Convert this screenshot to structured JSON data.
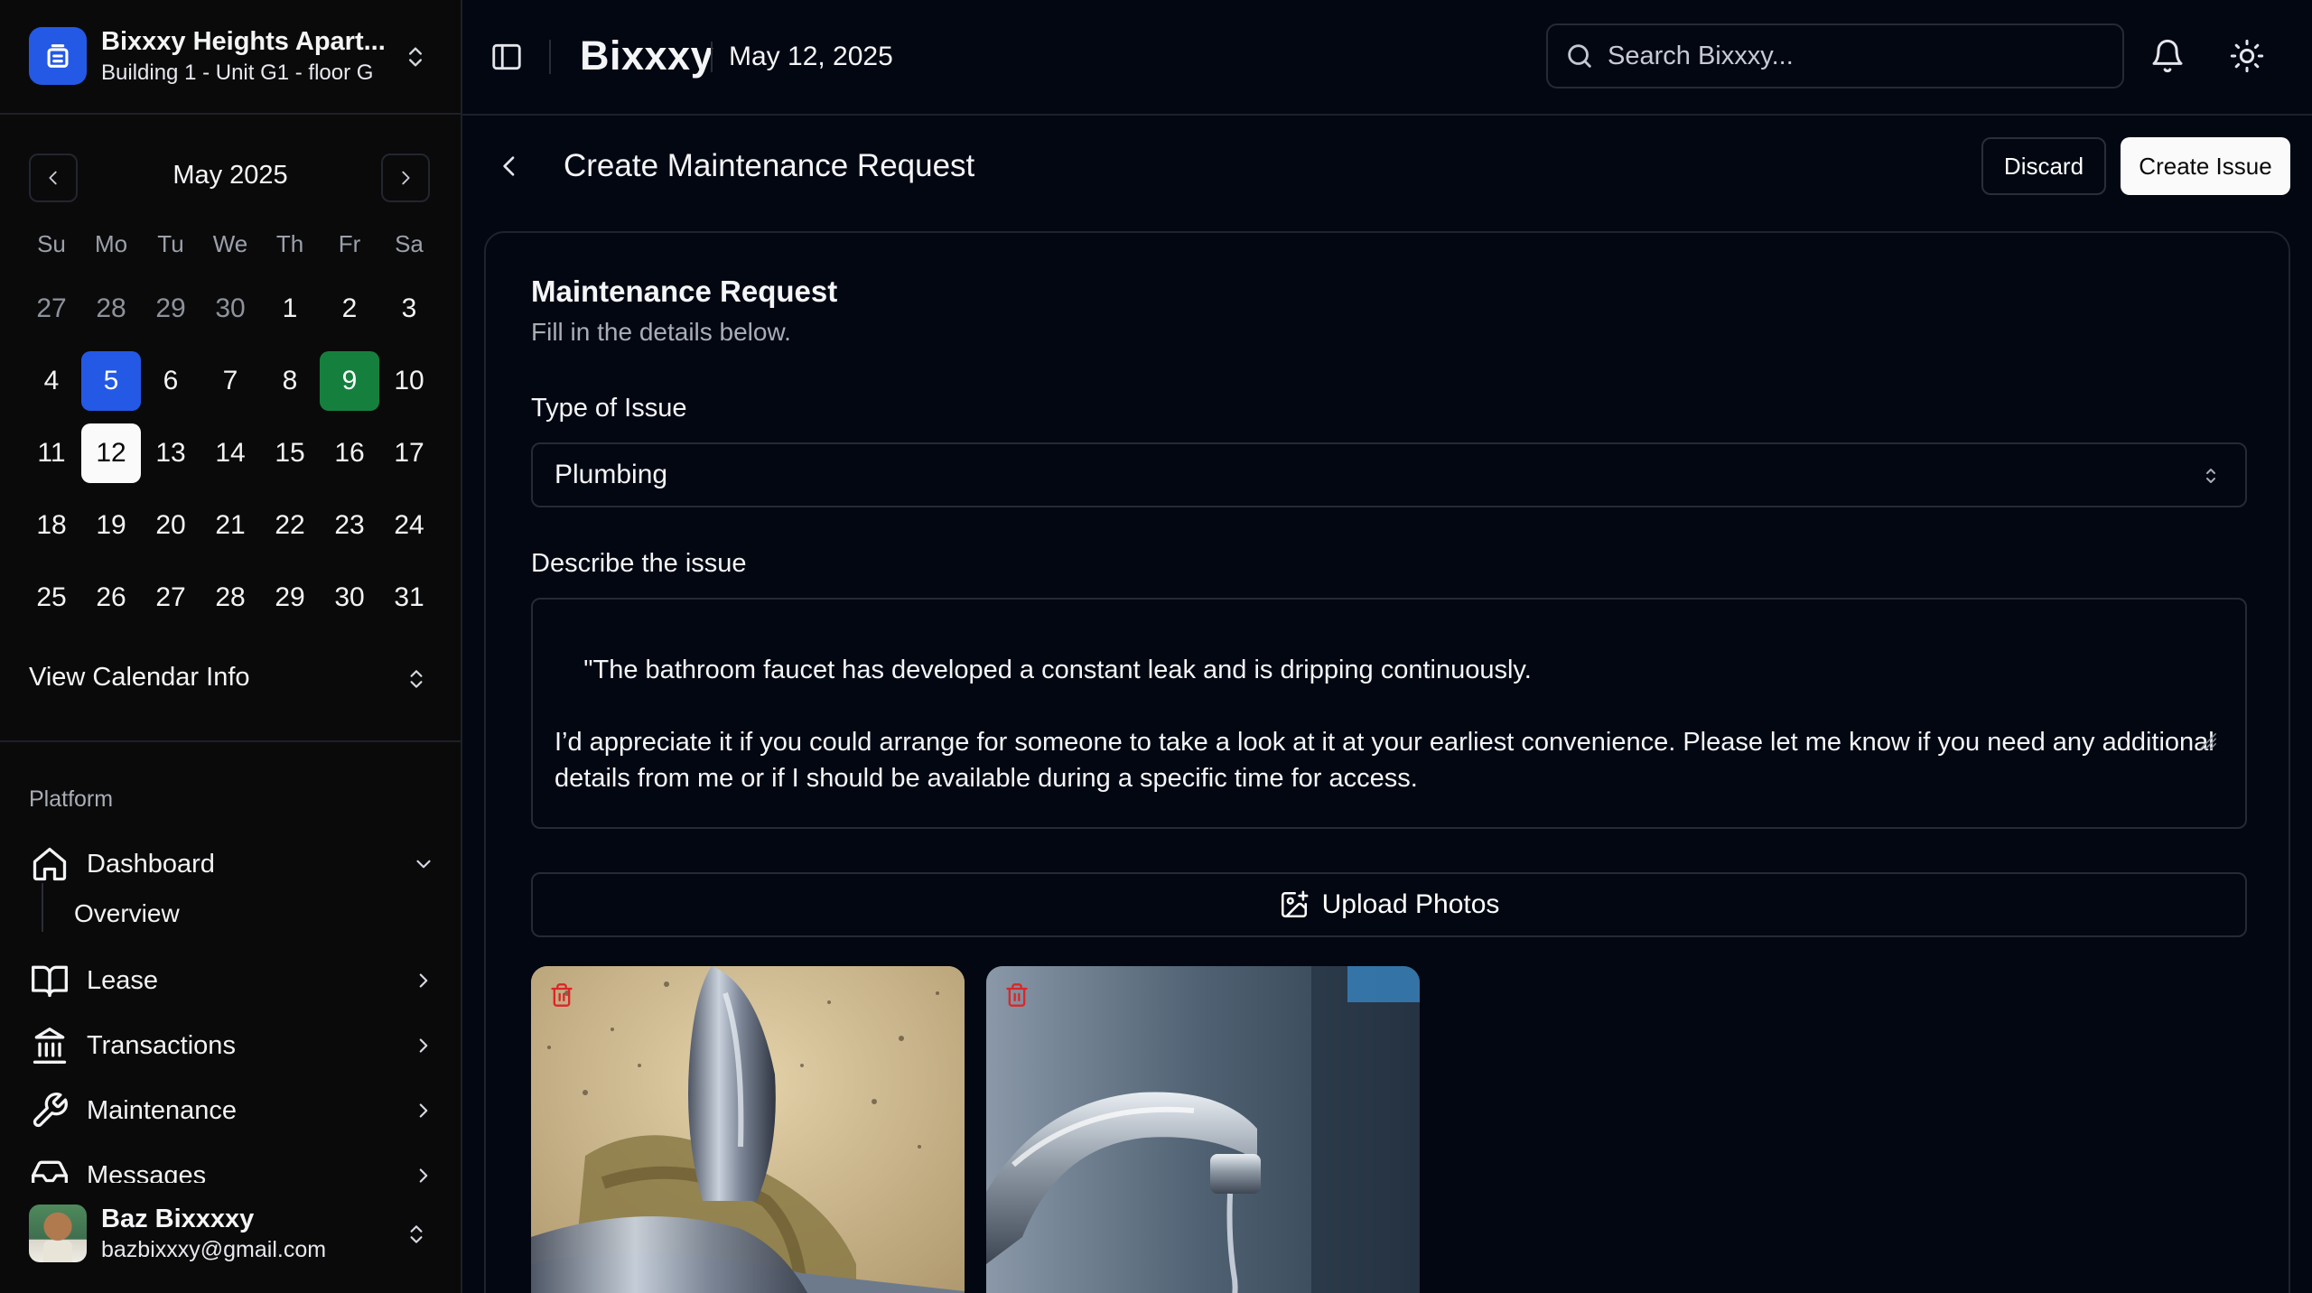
{
  "org": {
    "name": "Bixxxy Heights Apart...",
    "unit": "Building 1 - Unit G1 - floor G"
  },
  "calendar": {
    "month_label": "May 2025",
    "weekdays": [
      "Su",
      "Mo",
      "Tu",
      "We",
      "Th",
      "Fr",
      "Sa"
    ],
    "weeks": [
      [
        {
          "d": "27",
          "state": "muted"
        },
        {
          "d": "28",
          "state": "muted"
        },
        {
          "d": "29",
          "state": "muted"
        },
        {
          "d": "30",
          "state": "muted"
        },
        {
          "d": "1",
          "state": ""
        },
        {
          "d": "2",
          "state": ""
        },
        {
          "d": "3",
          "state": ""
        }
      ],
      [
        {
          "d": "4",
          "state": ""
        },
        {
          "d": "5",
          "state": "sel-blue"
        },
        {
          "d": "6",
          "state": ""
        },
        {
          "d": "7",
          "state": ""
        },
        {
          "d": "8",
          "state": ""
        },
        {
          "d": "9",
          "state": "sel-green"
        },
        {
          "d": "10",
          "state": ""
        }
      ],
      [
        {
          "d": "11",
          "state": ""
        },
        {
          "d": "12",
          "state": "today"
        },
        {
          "d": "13",
          "state": ""
        },
        {
          "d": "14",
          "state": ""
        },
        {
          "d": "15",
          "state": ""
        },
        {
          "d": "16",
          "state": ""
        },
        {
          "d": "17",
          "state": ""
        }
      ],
      [
        {
          "d": "18",
          "state": ""
        },
        {
          "d": "19",
          "state": ""
        },
        {
          "d": "20",
          "state": ""
        },
        {
          "d": "21",
          "state": ""
        },
        {
          "d": "22",
          "state": ""
        },
        {
          "d": "23",
          "state": ""
        },
        {
          "d": "24",
          "state": ""
        }
      ],
      [
        {
          "d": "25",
          "state": ""
        },
        {
          "d": "26",
          "state": ""
        },
        {
          "d": "27",
          "state": ""
        },
        {
          "d": "28",
          "state": ""
        },
        {
          "d": "29",
          "state": ""
        },
        {
          "d": "30",
          "state": ""
        },
        {
          "d": "31",
          "state": ""
        }
      ]
    ],
    "info_label": "View Calendar Info"
  },
  "nav": {
    "group_label": "Platform",
    "dashboard": {
      "label": "Dashboard",
      "icon": "home-icon"
    },
    "overview": {
      "label": "Overview"
    },
    "lease": {
      "label": "Lease",
      "icon": "book-open-icon"
    },
    "transactions": {
      "label": "Transactions",
      "icon": "landmark-icon"
    },
    "maintenance": {
      "label": "Maintenance",
      "icon": "wrench-icon"
    },
    "messages": {
      "label": "Messages",
      "icon": "inbox-icon"
    }
  },
  "user": {
    "name": "Baz Bixxxxy",
    "email": "bazbixxxy@gmail.com"
  },
  "topbar": {
    "brand": "Bixxxy",
    "date": "May 12, 2025",
    "search_placeholder": "Search Bixxxy..."
  },
  "page": {
    "title": "Create Maintenance Request",
    "discard_label": "Discard",
    "create_label": "Create Issue"
  },
  "form": {
    "card_title": "Maintenance Request",
    "card_description": "Fill in the details below.",
    "type_label": "Type of Issue",
    "type_value": "Plumbing",
    "describe_label": "Describe the issue",
    "description": "\"The bathroom faucet has developed a constant leak and is dripping continuously.\n\nI’d appreciate it if you could arrange for someone to take a look at it at your earliest convenience. Please let me know if you need any additional details from me or if I should be available during a specific time for access.",
    "upload_label": "Upload Photos"
  },
  "colors": {
    "background": "#030712",
    "sidebar": "#0a0a0b",
    "accent_blue": "#2459e6",
    "accent_green": "#15803d",
    "danger": "#dc2626"
  }
}
